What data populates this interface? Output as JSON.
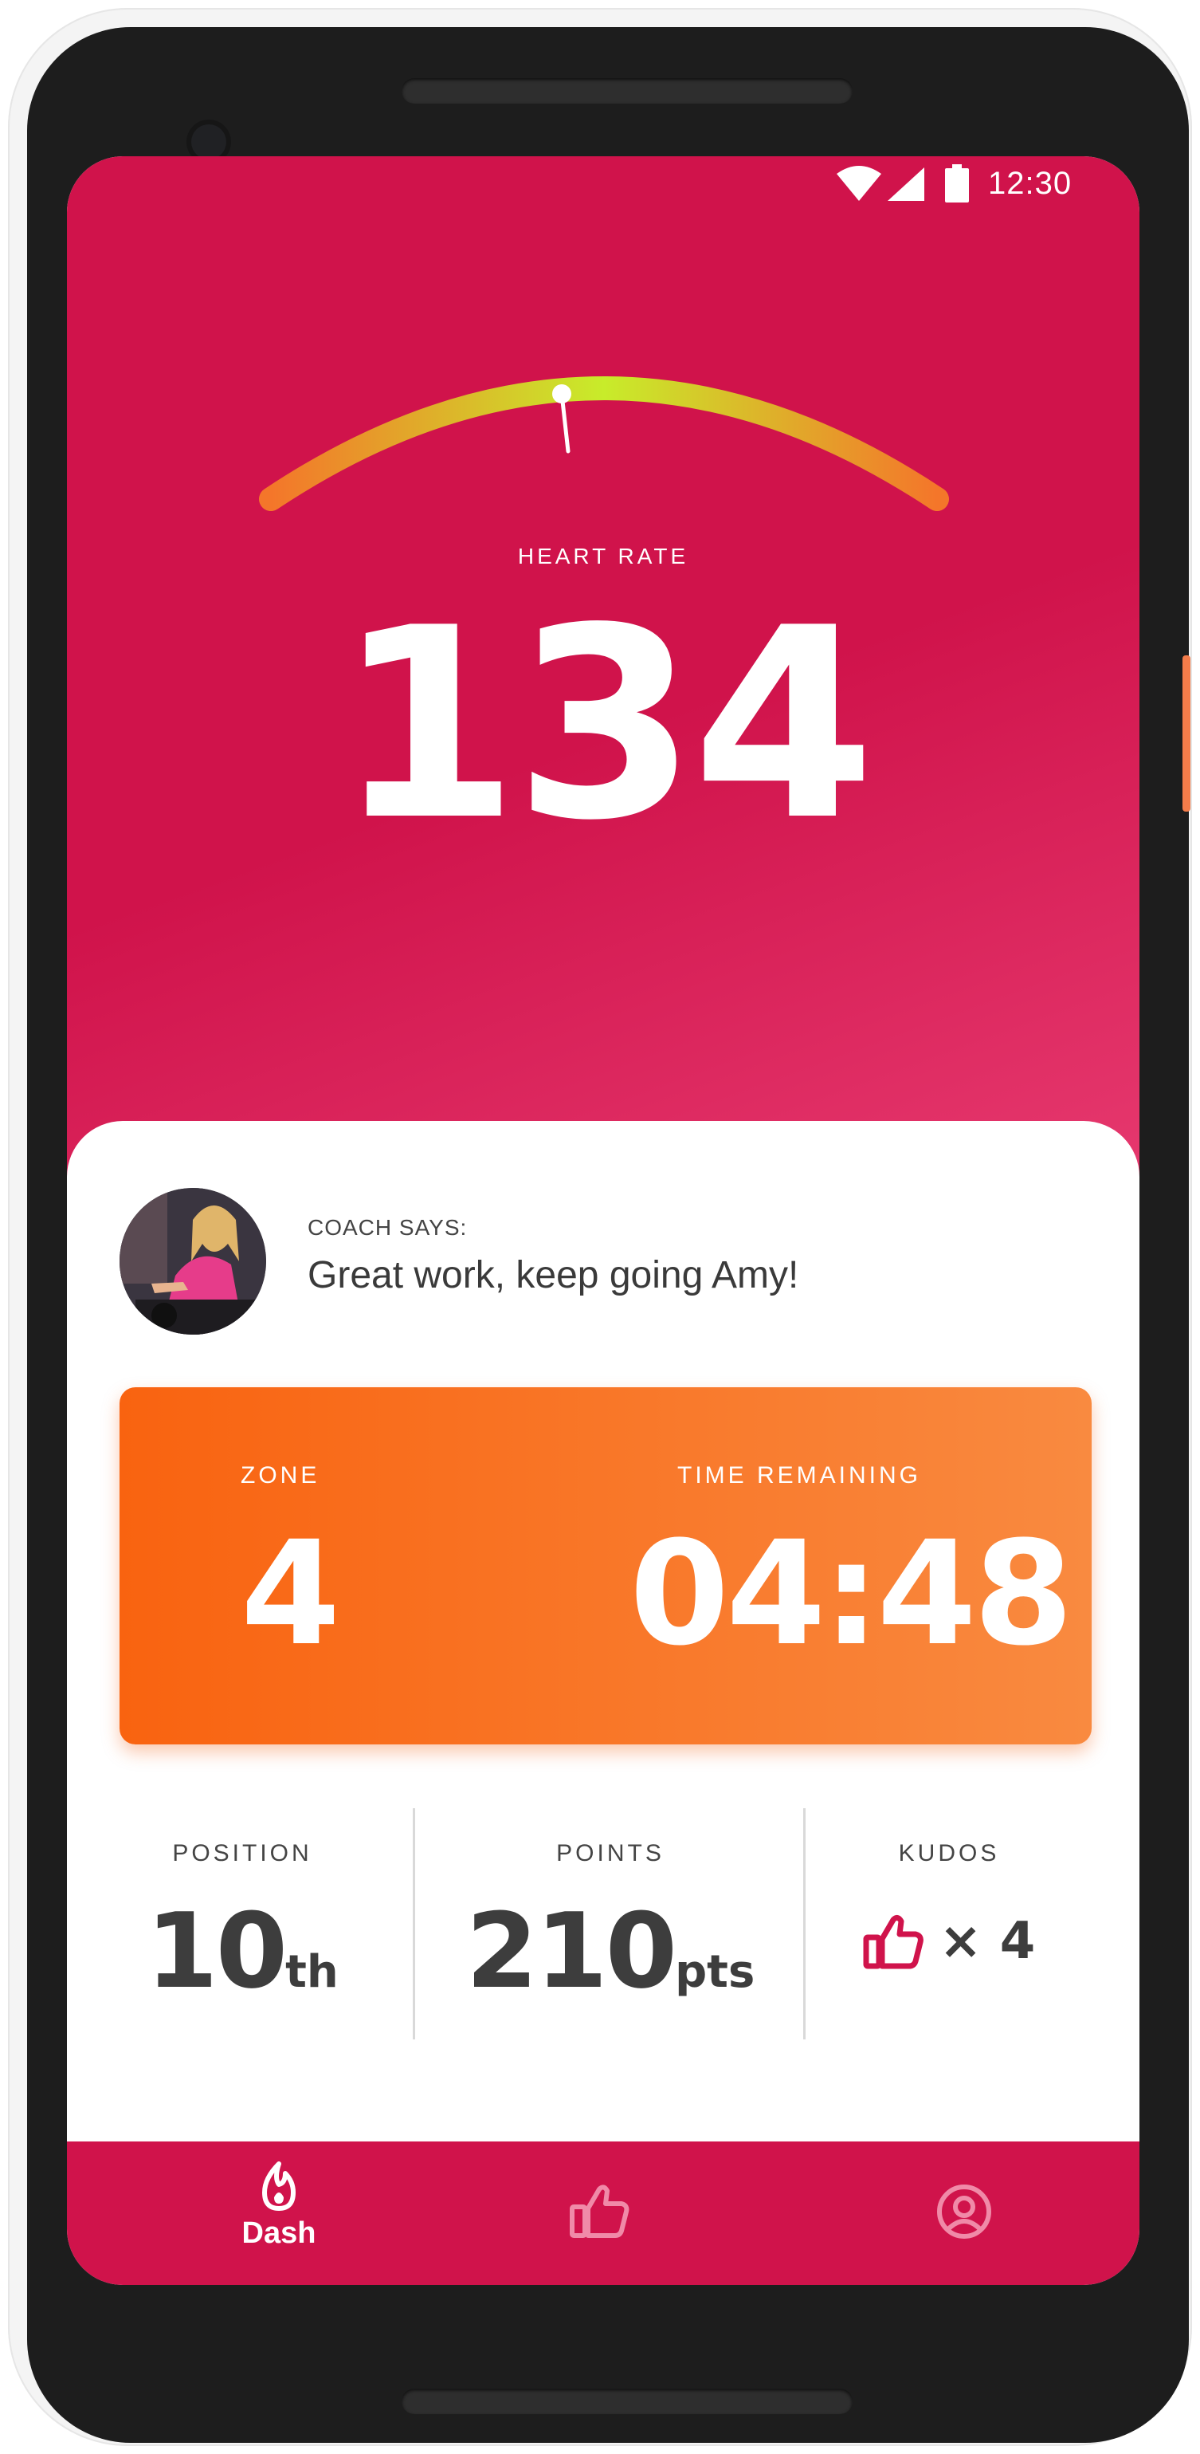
{
  "status_bar": {
    "time": "12:30"
  },
  "heart_rate": {
    "label": "HEART RATE",
    "value": "134",
    "gauge_level": 0.35
  },
  "coach": {
    "label": "COACH SAYS:",
    "message": "Great work, keep going Amy!"
  },
  "zone_card": {
    "zone_label": "ZONE",
    "zone_value": "4",
    "time_label": "TIME REMAINING",
    "time_value": "04:48"
  },
  "stats": {
    "position": {
      "label": "POSITION",
      "value": "10",
      "suffix": "th"
    },
    "points": {
      "label": "POINTS",
      "value": "210",
      "suffix": "pts"
    },
    "kudos": {
      "label": "KUDOS",
      "multiplier": "× 4"
    }
  },
  "nav": {
    "items": [
      {
        "label": "Dash",
        "icon": "flame-icon",
        "active": true
      },
      {
        "label": "",
        "icon": "thumbs-up-icon",
        "active": false
      },
      {
        "label": "",
        "icon": "profile-icon",
        "active": false
      }
    ]
  },
  "colors": {
    "brand": "#d0134b",
    "accent": "#f96310",
    "text": "#3d3d3d"
  }
}
